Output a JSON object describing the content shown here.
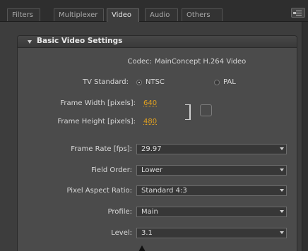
{
  "tabs": [
    {
      "label": "Filters",
      "active": false
    },
    {
      "label": "Multiplexer",
      "active": false
    },
    {
      "label": "Video",
      "active": true
    },
    {
      "label": "Audio",
      "active": false
    },
    {
      "label": "Others",
      "active": false
    }
  ],
  "menu_icon": "panel-menu-icon",
  "section": {
    "title": "Basic Video Settings",
    "expanded": true
  },
  "codec": {
    "label": "Codec:",
    "value": "MainConcept H.264 Video"
  },
  "tv_standard": {
    "label": "TV Standard:",
    "options": [
      "NTSC",
      "PAL"
    ],
    "selected": "NTSC"
  },
  "frame_width": {
    "label": "Frame Width [pixels]:",
    "value": "640"
  },
  "frame_height": {
    "label": "Frame Height [pixels]:",
    "value": "480"
  },
  "link_dimensions": {
    "checked": false
  },
  "frame_rate": {
    "label": "Frame Rate [fps]:",
    "value": "29.97"
  },
  "field_order": {
    "label": "Field Order:",
    "value": "Lower"
  },
  "pixel_aspect_ratio": {
    "label": "Pixel Aspect Ratio:",
    "value": "Standard 4:3"
  },
  "profile": {
    "label": "Profile:",
    "value": "Main"
  },
  "level": {
    "label": "Level:",
    "value": "3.1"
  },
  "colors": {
    "accent_orange": "#e0a020",
    "panel_bg": "#4b4b4b",
    "window_bg": "#3d3d3d"
  }
}
